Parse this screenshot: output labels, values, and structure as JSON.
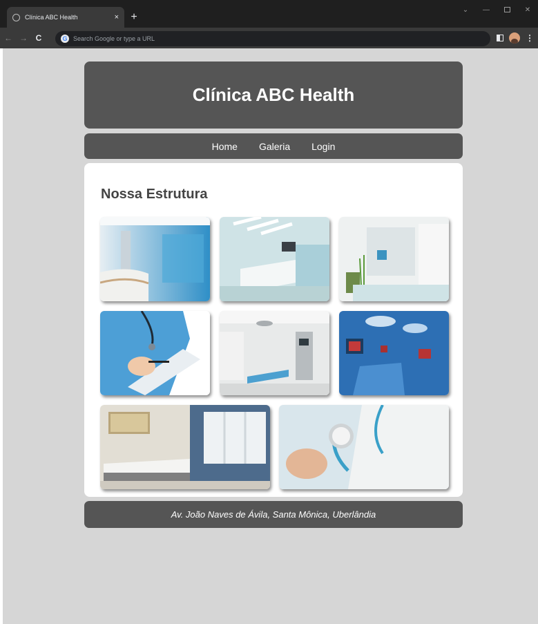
{
  "browser": {
    "tab_title": "Clínica ABC Health",
    "tab_close": "×",
    "new_tab": "+",
    "omnibox_placeholder": "Search Google or type a URL",
    "google_letter": "G",
    "back": "←",
    "forward": "→",
    "reload": "C",
    "menu": "⋮"
  },
  "site": {
    "title": "Clínica ABC Health",
    "nav": [
      "Home",
      "Galeria",
      "Login"
    ],
    "section_title": "Nossa Estrutura",
    "gallery": [
      {
        "name": "reception-hallway-photo"
      },
      {
        "name": "reception-desk-photo"
      },
      {
        "name": "waiting-room-photo"
      },
      {
        "name": "nurse-clipboard-photo"
      },
      {
        "name": "operating-room-photo"
      },
      {
        "name": "surgical-suite-photo"
      },
      {
        "name": "exam-room-photo"
      },
      {
        "name": "doctor-stethoscope-photo"
      }
    ],
    "address": "Av. João Naves de Ávila, Santa Mônica, Uberlândia"
  },
  "colors": {
    "panel": "#555555",
    "page_background": "#d6d6d6",
    "card": "#ffffff",
    "chrome_dark": "#1f1f1f",
    "chrome_toolbar": "#3a3a3a"
  }
}
